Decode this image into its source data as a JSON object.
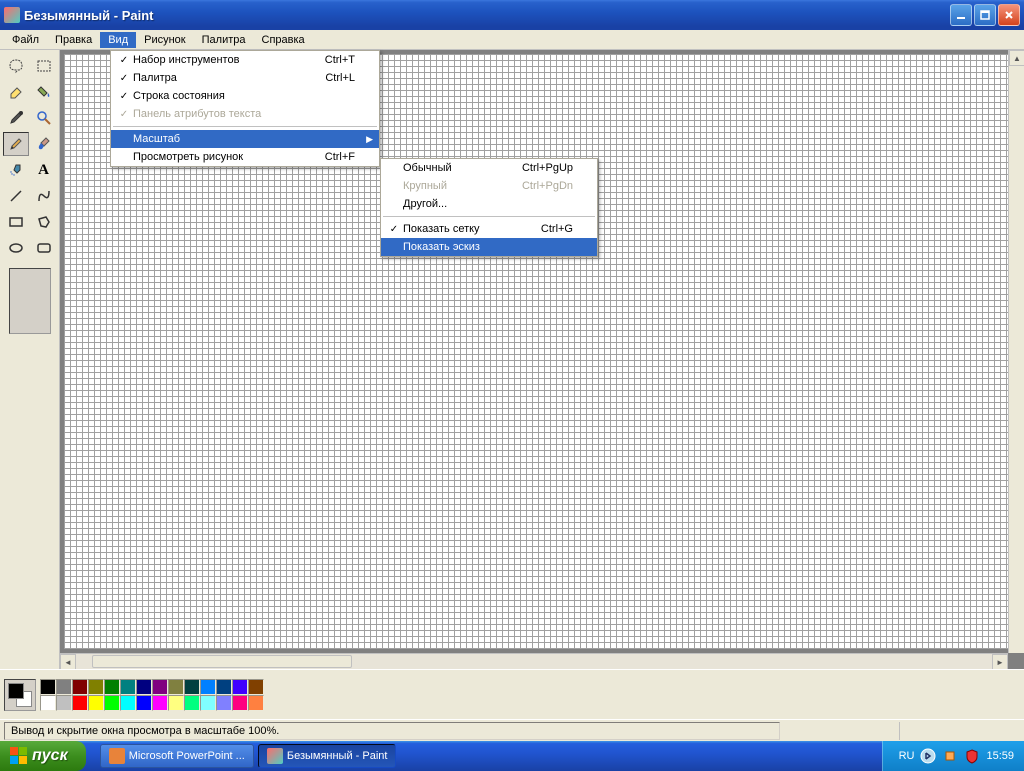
{
  "window": {
    "title": "Безымянный - Paint"
  },
  "menubar": [
    "Файл",
    "Правка",
    "Вид",
    "Рисунок",
    "Палитра",
    "Справка"
  ],
  "menu_view": {
    "items": [
      {
        "check": true,
        "label": "Набор инструментов",
        "shortcut": "Ctrl+T"
      },
      {
        "check": true,
        "label": "Палитра",
        "shortcut": "Ctrl+L"
      },
      {
        "check": true,
        "label": "Строка состояния",
        "shortcut": ""
      },
      {
        "check": true,
        "label": "Панель атрибутов текста",
        "shortcut": "",
        "disabled": true
      }
    ],
    "items2": [
      {
        "label": "Масштаб",
        "submenu": true,
        "highlighted": true
      },
      {
        "label": "Просмотреть рисунок",
        "shortcut": "Ctrl+F"
      }
    ]
  },
  "menu_zoom": {
    "items": [
      {
        "label": "Обычный",
        "shortcut": "Ctrl+PgUp"
      },
      {
        "label": "Крупный",
        "shortcut": "Ctrl+PgDn",
        "disabled": true
      },
      {
        "label": "Другой...",
        "shortcut": ""
      }
    ],
    "items2": [
      {
        "check": true,
        "label": "Показать сетку",
        "shortcut": "Ctrl+G"
      },
      {
        "label": "Показать эскиз",
        "shortcut": "",
        "highlighted": true
      }
    ]
  },
  "palette_colors_row1": [
    "#000000",
    "#808080",
    "#800000",
    "#808000",
    "#008000",
    "#008080",
    "#000080",
    "#800080",
    "#808040",
    "#004040",
    "#0080ff",
    "#004080",
    "#4000ff",
    "#804000"
  ],
  "palette_colors_row2": [
    "#ffffff",
    "#c0c0c0",
    "#ff0000",
    "#ffff00",
    "#00ff00",
    "#00ffff",
    "#0000ff",
    "#ff00ff",
    "#ffff80",
    "#00ff80",
    "#80ffff",
    "#8080ff",
    "#ff0080",
    "#ff8040"
  ],
  "statusbar": {
    "text": "Вывод и скрытие окна просмотра в масштабе 100%."
  },
  "taskbar": {
    "start": "пуск",
    "tasks": [
      {
        "label": "Microsoft PowerPoint ...",
        "active": false
      },
      {
        "label": "Безымянный - Paint",
        "active": true
      }
    ],
    "lang": "RU",
    "time": "15:59"
  }
}
